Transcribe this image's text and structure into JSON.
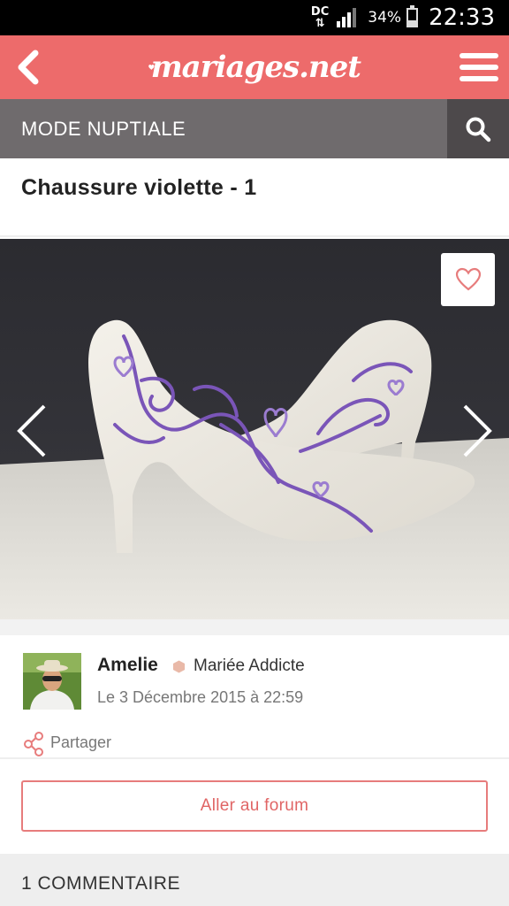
{
  "status_bar": {
    "network_line1": "DC",
    "network_line2": "⇅",
    "battery_percent": "34%",
    "battery_level": 0.34,
    "time": "22:33"
  },
  "header": {
    "logo_text": "mariages.net",
    "back_icon": "chevron-left-icon",
    "menu_icon": "hamburger-menu-icon",
    "background": "#ed6b6b"
  },
  "section": {
    "title": "MODE NUPTIALE",
    "search_icon": "search-icon"
  },
  "post": {
    "title": "Chaussure violette - 1",
    "image": {
      "description_icon": "photo-shoe",
      "favorite_icon": "heart-outline-icon",
      "prev_icon": "chevron-left-icon",
      "next_icon": "chevron-right-icon"
    },
    "author": {
      "name": "Amelie",
      "rank": "Mariée Addicte",
      "date": "Le 3 Décembre 2015 à 22:59"
    },
    "share_label": "Partager",
    "forum_button": "Aller au forum"
  },
  "comments": {
    "header": "1 COMMENTAIRE"
  },
  "colors": {
    "brand": "#ed6b6b",
    "section_bar": "#6f6b6d",
    "search_bg": "#4d494b",
    "accent_text": "#e06565"
  }
}
